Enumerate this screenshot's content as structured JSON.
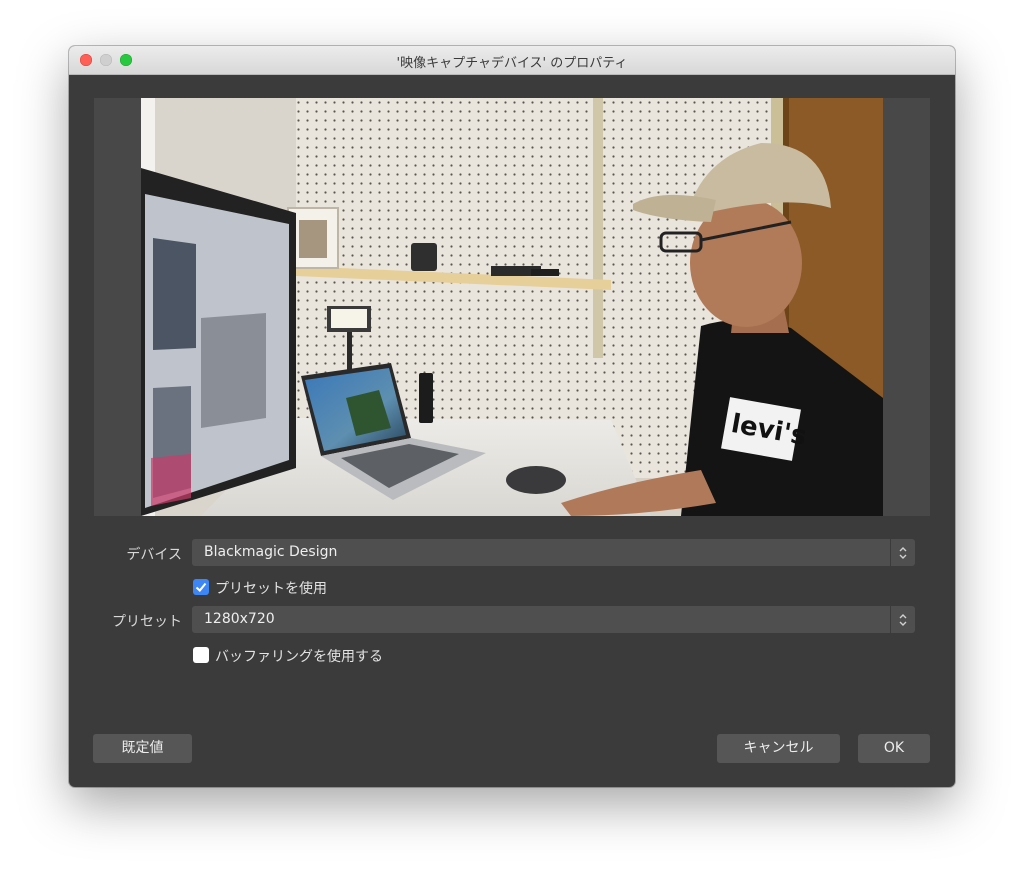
{
  "window": {
    "title": "'映像キャプチャデバイス' のプロパティ"
  },
  "form": {
    "device_label": "デバイス",
    "device_value": "Blackmagic Design",
    "use_preset_label": "プリセットを使用",
    "use_preset_checked": true,
    "preset_label": "プリセット",
    "preset_value": "1280x720",
    "use_buffering_label": "バッファリングを使用する",
    "use_buffering_checked": false
  },
  "buttons": {
    "defaults": "既定値",
    "cancel": "キャンセル",
    "ok": "OK"
  },
  "preview": {
    "shirt_text": "levi's"
  },
  "colors": {
    "accent": "#3d86f6",
    "window_bg": "#3b3b3b",
    "close": "#fe5f57",
    "maximize": "#28c840"
  }
}
